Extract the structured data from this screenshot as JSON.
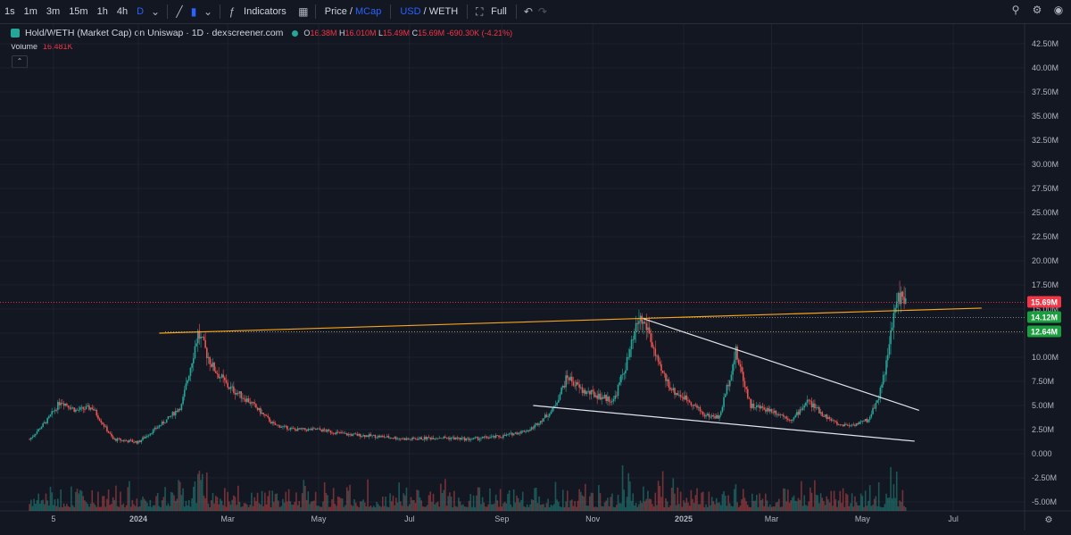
{
  "toolbar": {
    "intervals": [
      "1s",
      "1m",
      "3m",
      "15m",
      "1h",
      "4h",
      "D"
    ],
    "active_interval": "D",
    "indicators_label": "Indicators",
    "price_label": "Price",
    "slash": "/",
    "mcap_label": "MCap",
    "usd_label": "USD",
    "weth_label": "WETH",
    "full_label": "Full"
  },
  "legend": {
    "title": "Hold/WETH (Market Cap) on Uniswap · 1D · dexscreener.com",
    "o_label": "O",
    "o_value": "16.38M",
    "h_label": "H",
    "h_value": "16.010M",
    "l_label": "L",
    "l_value": "15.49M",
    "c_label": "C",
    "c_value": "15.69M",
    "change": "-690.30K (-4.21%)",
    "volume_label": "Volume",
    "volume_value": "16.481K"
  },
  "colors": {
    "background": "#131722",
    "up": "#26a69a",
    "down": "#ef5350",
    "trendline_orange": "#f7a21b",
    "trendline_white": "#e0e3eb",
    "last_price_tag": "#f23645",
    "level_tag": "#1b9e3e"
  },
  "price_tags": [
    {
      "label": "15.69M",
      "value": 15.69,
      "color": "#f23645"
    },
    {
      "label": "14.12M",
      "value": 14.12,
      "color": "#1b9e3e"
    },
    {
      "label": "12.64M",
      "value": 12.64,
      "color": "#1b9e3e"
    }
  ],
  "chart_data": {
    "type": "candlestick",
    "ylabel_unit": "M",
    "ylim": [
      -5.0,
      43.0
    ],
    "y_ticks": [
      "42.50M",
      "40.00M",
      "37.50M",
      "35.00M",
      "32.50M",
      "30.00M",
      "27.50M",
      "25.00M",
      "22.50M",
      "20.00M",
      "17.50M",
      "15.00M",
      "12.50M",
      "10.00M",
      "7.50M",
      "5.00M",
      "2.50M",
      "0.000",
      "-2.50M",
      "-5.00M"
    ],
    "y_tick_values": [
      42.5,
      40,
      37.5,
      35,
      32.5,
      30,
      27.5,
      25,
      22.5,
      20,
      17.5,
      15,
      12.5,
      10,
      7.5,
      5,
      2.5,
      0,
      -2.5,
      -5
    ],
    "x_ticks": [
      "5",
      "2024",
      "Mar",
      "May",
      "Jul",
      "Sep",
      "Nov",
      "2025",
      "Mar",
      "May",
      "Jul"
    ],
    "x_tick_dates": [
      "2023-11-05",
      "2024-01-01",
      "2024-03-01",
      "2024-05-01",
      "2024-07-01",
      "2024-09-01",
      "2024-11-01",
      "2025-01-01",
      "2025-03-01",
      "2025-05-01",
      "2025-07-01"
    ],
    "series_path_dates": [
      "2023-10-20",
      "2023-11-01",
      "2023-11-10",
      "2023-11-20",
      "2023-12-01",
      "2023-12-15",
      "2024-01-01",
      "2024-01-20",
      "2024-01-30",
      "2024-02-10",
      "2024-02-20",
      "2024-03-01",
      "2024-03-15",
      "2024-04-01",
      "2024-04-15",
      "2024-05-01",
      "2024-05-20",
      "2024-06-10",
      "2024-07-01",
      "2024-07-20",
      "2024-08-10",
      "2024-09-01",
      "2024-09-20",
      "2024-10-05",
      "2024-10-15",
      "2024-10-25",
      "2024-11-05",
      "2024-11-15",
      "2024-11-25",
      "2024-12-02",
      "2024-12-08",
      "2024-12-15",
      "2024-12-25",
      "2025-01-05",
      "2025-01-15",
      "2025-01-25",
      "2025-02-05",
      "2025-02-15",
      "2025-03-01",
      "2025-03-15",
      "2025-03-25",
      "2025-04-05",
      "2025-04-15",
      "2025-04-25",
      "2025-05-05",
      "2025-05-12",
      "2025-05-18",
      "2025-05-22",
      "2025-05-26",
      "2025-05-30"
    ],
    "series_path_values": [
      1.5,
      3.5,
      5.5,
      4.5,
      4.8,
      1.5,
      1.2,
      3.5,
      5.0,
      12.5,
      9.0,
      7.0,
      5.5,
      3.0,
      2.5,
      2.5,
      2.0,
      1.8,
      1.5,
      1.7,
      1.5,
      1.8,
      2.5,
      4.5,
      8.0,
      6.5,
      6.0,
      5.5,
      10.0,
      14.0,
      13.0,
      9.0,
      6.5,
      5.5,
      4.0,
      3.8,
      10.5,
      5.0,
      4.5,
      3.5,
      5.5,
      4.0,
      3.0,
      3.0,
      3.5,
      6.0,
      10.0,
      14.5,
      16.5,
      15.69
    ],
    "levels": [
      15.69,
      14.12,
      12.64
    ],
    "trendlines": [
      {
        "name": "resistance",
        "color": "#f7a21b",
        "from": [
          "2024-01-15",
          12.5
        ],
        "to": [
          "2025-07-20",
          15.1
        ]
      },
      {
        "name": "upper-wedge",
        "color": "#e0e3eb",
        "from": [
          "2024-12-05",
          14.0
        ],
        "to": [
          "2025-06-08",
          4.5
        ]
      },
      {
        "name": "lower-wedge",
        "color": "#e0e3eb",
        "from": [
          "2024-09-22",
          5.0
        ],
        "to": [
          "2025-06-05",
          1.3
        ]
      }
    ]
  }
}
